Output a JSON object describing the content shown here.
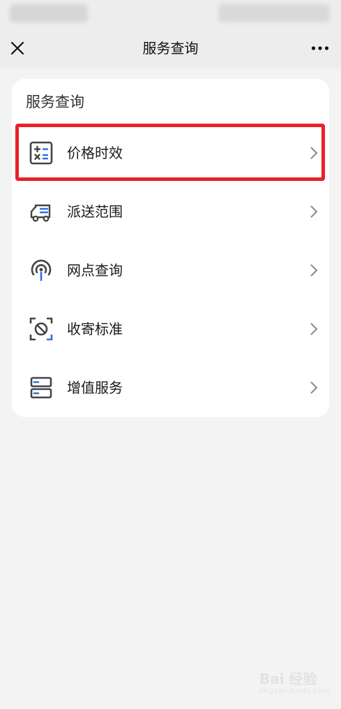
{
  "header": {
    "title": "服务查询"
  },
  "section": {
    "title": "服务查询",
    "items": [
      {
        "label": "价格时效",
        "icon": "calculator-icon"
      },
      {
        "label": "派送范围",
        "icon": "delivery-truck-icon"
      },
      {
        "label": "网点查询",
        "icon": "location-pin-icon"
      },
      {
        "label": "收寄标准",
        "icon": "prohibited-scan-icon"
      },
      {
        "label": "增值服务",
        "icon": "server-stack-icon"
      }
    ]
  },
  "colors": {
    "accent": "#2f6fe4",
    "icon": "#444444",
    "highlight": "#e8202a",
    "background": "#f3f3f3"
  },
  "watermark": {
    "text": "Bai 经验",
    "url": "jingyan.baidu.com"
  }
}
